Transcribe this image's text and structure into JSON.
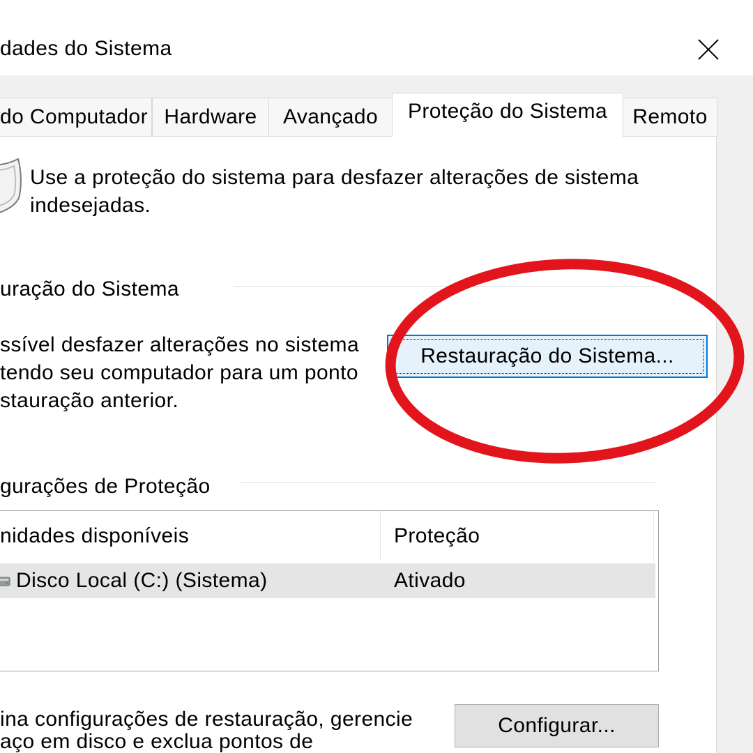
{
  "window": {
    "title": "dades do Sistema",
    "close_icon": "close-icon"
  },
  "tabs": [
    {
      "label": "do Computador",
      "selected": false
    },
    {
      "label": "Hardware",
      "selected": false
    },
    {
      "label": "Avançado",
      "selected": false
    },
    {
      "label": "Proteção do Sistema",
      "selected": true
    },
    {
      "label": "Remoto",
      "selected": false
    }
  ],
  "panel": {
    "intro": {
      "icon": "shield-icon",
      "lines": [
        "Use a proteção do sistema para desfazer alterações de sistema",
        "indesejadas."
      ]
    },
    "restore": {
      "group_label": "uração do Sistema",
      "lines": [
        "ssível desfazer alterações no sistema",
        "tendo seu computador para um ponto",
        "stauração anterior."
      ],
      "button_label": "Restauração do Sistema..."
    },
    "protection": {
      "group_label": "gurações de Proteção",
      "columns": [
        "nidades disponíveis",
        "Proteção"
      ],
      "rows": [
        {
          "icon": "drive-icon",
          "drive": "Disco Local (C:) (Sistema)",
          "protection": "Ativado"
        }
      ],
      "config_lines": [
        "ina configurações de restauração, gerencie",
        "aço em disco e exclua pontos de"
      ],
      "config_button_label": "Configurar..."
    }
  },
  "colors": {
    "focus_border": "#0078d7",
    "focus_fill": "#e5f1fb",
    "annotation": "#e3151c"
  }
}
